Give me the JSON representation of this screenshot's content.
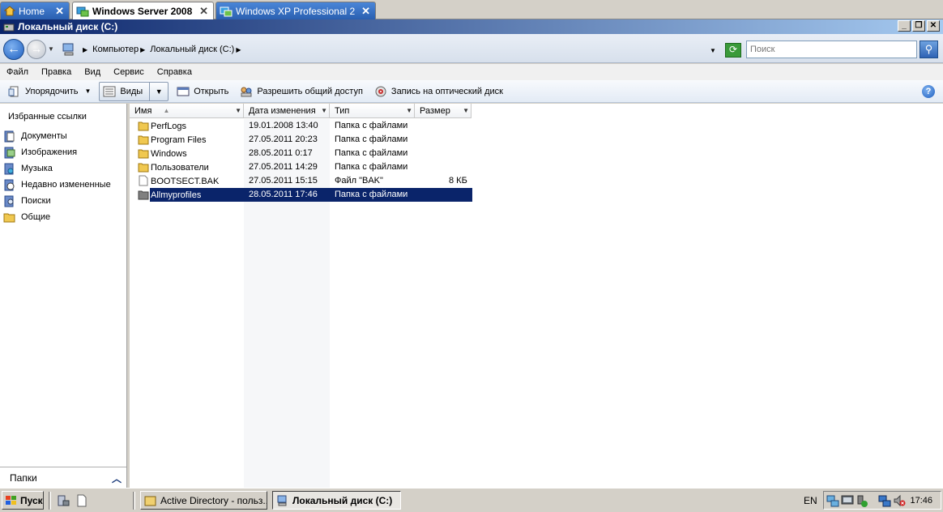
{
  "vm_tabs": [
    {
      "label": "Home",
      "close": "✕"
    },
    {
      "label": "Windows Server 2008",
      "close": "✕"
    },
    {
      "label": "Windows XP Professional 2",
      "close": "✕"
    }
  ],
  "window": {
    "title": "Локальный диск (C:)",
    "minimize": "_",
    "restore": "❐",
    "close": "✕"
  },
  "address": {
    "crumbs": [
      "Компьютер",
      "Локальный диск (C:)"
    ],
    "search_placeholder": "Поиск"
  },
  "menu": [
    "Файл",
    "Правка",
    "Вид",
    "Сервис",
    "Справка"
  ],
  "commands": {
    "organize": "Упорядочить",
    "views": "Виды",
    "open": "Открыть",
    "share": "Разрешить общий доступ",
    "burn": "Запись на оптический диск"
  },
  "nav": {
    "header": "Избранные ссылки",
    "items": [
      "Документы",
      "Изображения",
      "Музыка",
      "Недавно измененные",
      "Поиски",
      "Общие"
    ],
    "folders_label": "Папки"
  },
  "columns": [
    "Имя",
    "Дата изменения",
    "Тип",
    "Размер"
  ],
  "files": [
    {
      "name": "PerfLogs",
      "date": "19.01.2008 13:40",
      "type": "Папка с файлами",
      "size": "",
      "kind": "folder"
    },
    {
      "name": "Program Files",
      "date": "27.05.2011 20:23",
      "type": "Папка с файлами",
      "size": "",
      "kind": "folder"
    },
    {
      "name": "Windows",
      "date": "28.05.2011 0:17",
      "type": "Папка с файлами",
      "size": "",
      "kind": "folder"
    },
    {
      "name": "Пользователи",
      "date": "27.05.2011 14:29",
      "type": "Папка с файлами",
      "size": "",
      "kind": "folder"
    },
    {
      "name": "BOOTSECT.BAK",
      "date": "27.05.2011 15:15",
      "type": "Файл \"BAK\"",
      "size": "8 КБ",
      "kind": "file"
    },
    {
      "name": "Allmyprofiles",
      "date": "28.05.2011 17:46",
      "type": "Папка с файлами",
      "size": "",
      "kind": "folder",
      "selected": true
    }
  ],
  "taskbar": {
    "start": "Пуск",
    "tasks": [
      "Active Directory - польз...",
      "Локальный диск (C:)"
    ],
    "lang": "EN",
    "time": "17:46"
  },
  "colors": {
    "title_start": "#0a246a",
    "title_end": "#a6caf0",
    "selection": "#0a246a",
    "vm_tab_blue": "#2a5fb0"
  }
}
